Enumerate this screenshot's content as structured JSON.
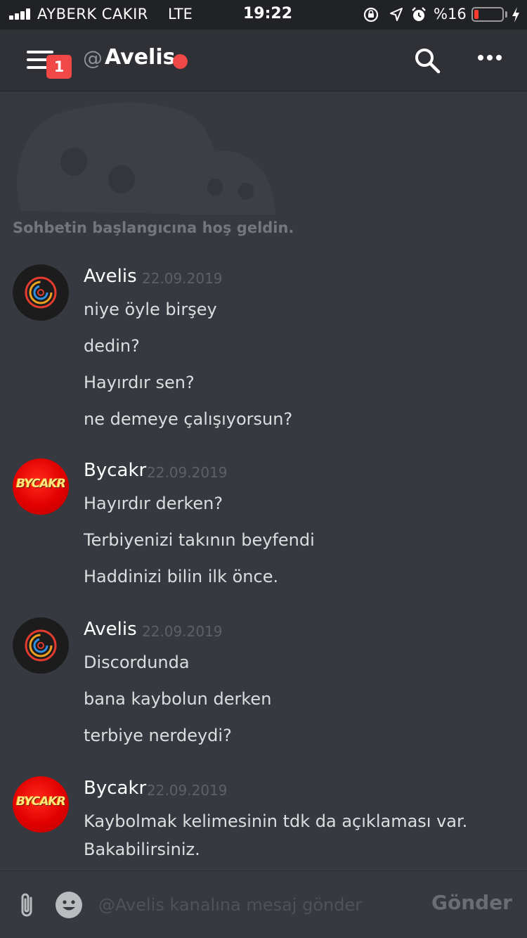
{
  "status_bar": {
    "carrier": "AYBERK CAKIR",
    "network": "LTE",
    "time": "19:22",
    "battery_percent_label": "%16",
    "battery_level": 0.16,
    "icons": [
      "lock-rotation-icon",
      "location-arrow-icon",
      "alarm-icon",
      "charging-bolt-icon"
    ]
  },
  "header": {
    "notification_count": "1",
    "at_symbol": "@",
    "channel_name": "Avelis",
    "status": "do-not-disturb",
    "status_color": "#f04747"
  },
  "welcome": {
    "text": "Sohbetin başlangıcına hoş geldin."
  },
  "messages": [
    {
      "author": "Avelis",
      "timestamp": "22.09.2019",
      "avatar": "avelis",
      "lines": [
        "niye öyle birşey",
        "dedin?",
        "Hayırdır sen?",
        "ne demeye çalışıyorsun?"
      ]
    },
    {
      "author": "Bycakr",
      "timestamp": "22.09.2019",
      "avatar": "bycakr",
      "avatar_text": "BYCAKR",
      "lines": [
        "Hayırdır derken?",
        "Terbiyenizi takının beyfendi",
        "Haddinizi bilin ilk önce."
      ]
    },
    {
      "author": "Avelis",
      "timestamp": "22.09.2019",
      "avatar": "avelis",
      "lines": [
        "Discordunda",
        "bana kaybolun derken",
        "terbiye nerdeydi?"
      ]
    },
    {
      "author": "Bycakr",
      "timestamp": "22.09.2019",
      "avatar": "bycakr",
      "avatar_text": "BYCAKR",
      "lines": [
        "Kaybolmak kelimesinin tdk da açıklaması var.",
        "Bakabilirsiniz."
      ]
    }
  ],
  "composer": {
    "placeholder": "@Avelis kanalına mesaj gönder",
    "value": "",
    "send_label": "Gönder"
  },
  "colors": {
    "background": "#36393f",
    "header": "#2f3136",
    "status_bar": "#202225",
    "accent_red": "#f04747"
  }
}
